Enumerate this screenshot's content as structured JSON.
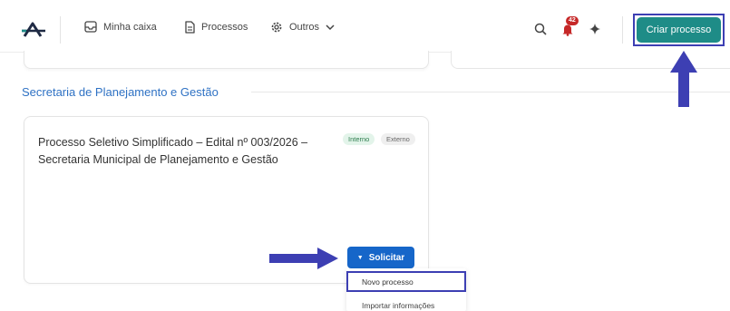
{
  "topbar": {
    "logo_icon": "app-logo-icon",
    "nav": [
      {
        "icon": "inbox-icon",
        "label": "Minha caixa"
      },
      {
        "icon": "document-icon",
        "label": "Processos"
      },
      {
        "icon": "gear-icon",
        "label": "Outros"
      }
    ],
    "notifications_count": "42",
    "create_button_label": "Criar processo"
  },
  "section": {
    "title": "Secretaria de Planejamento e Gestão"
  },
  "card": {
    "title": "Processo Seletivo Simplificado – Edital nº 003/2026 – Secretaria Municipal de Planejamento e Gestão",
    "tags": [
      "Interno",
      "Externo"
    ],
    "action_label": "Solicitar"
  },
  "dropdown": {
    "items": [
      "Novo processo",
      "Importar informações"
    ]
  },
  "colors": {
    "accent_teal": "#1e8c87",
    "primary_blue": "#1666c9",
    "section_title": "#2f72c4",
    "annotation": "#3d3fb3"
  }
}
